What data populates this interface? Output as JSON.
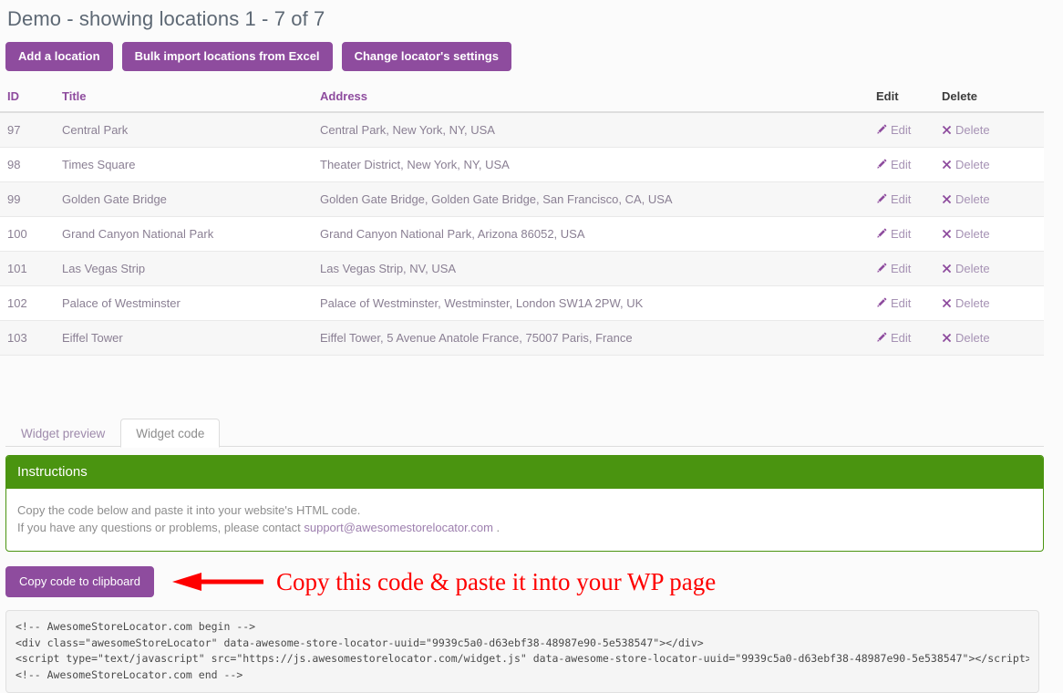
{
  "page": {
    "title": "Demo - showing locations 1 - 7 of 7",
    "accent_purple": "#8e4c9e",
    "accent_green": "#4a9410",
    "annotation_red": "#fe0000"
  },
  "toolbar": {
    "add_location_label": "Add a location",
    "bulk_import_label": "Bulk import locations from Excel",
    "settings_label": "Change locator's settings"
  },
  "table": {
    "columns": {
      "id": "ID",
      "title": "Title",
      "address": "Address",
      "edit": "Edit",
      "delete": "Delete"
    },
    "row_action_edit": "Edit",
    "row_action_delete": "Delete",
    "rows": [
      {
        "id": "97",
        "title": "Central Park",
        "address": "Central Park, New York, NY, USA"
      },
      {
        "id": "98",
        "title": "Times Square",
        "address": "Theater District, New York, NY, USA"
      },
      {
        "id": "99",
        "title": "Golden Gate Bridge",
        "address": "Golden Gate Bridge, Golden Gate Bridge, San Francisco, CA, USA"
      },
      {
        "id": "100",
        "title": "Grand Canyon National Park",
        "address": "Grand Canyon National Park, Arizona 86052, USA"
      },
      {
        "id": "101",
        "title": "Las Vegas Strip",
        "address": "Las Vegas Strip, NV, USA"
      },
      {
        "id": "102",
        "title": "Palace of Westminster",
        "address": "Palace of Westminster, Westminster, London SW1A 2PW, UK"
      },
      {
        "id": "103",
        "title": "Eiffel Tower",
        "address": "Eiffel Tower, 5 Avenue Anatole France, 75007 Paris, France"
      }
    ]
  },
  "tabs": {
    "preview_label": "Widget preview",
    "code_label": "Widget code",
    "active": "Widget code"
  },
  "instructions": {
    "heading": "Instructions",
    "line1": "Copy the code below and paste it into your website's HTML code.",
    "line2_prefix": "If you have any questions or problems, please contact ",
    "support_email": "support@awesomestorelocator.com",
    "line2_suffix": " ."
  },
  "copy": {
    "button_label": "Copy code to clipboard",
    "annotation": "Copy this code & paste it into your WP page"
  },
  "code_snippet": "<!-- AwesomeStoreLocator.com begin -->\n<div class=\"awesomeStoreLocator\" data-awesome-store-locator-uuid=\"9939c5a0-d63ebf38-48987e90-5e538547\"></div>\n<script type=\"text/javascript\" src=\"https://js.awesomestorelocator.com/widget.js\" data-awesome-store-locator-uuid=\"9939c5a0-d63ebf38-48987e90-5e538547\"></script>\n<!-- AwesomeStoreLocator.com end -->"
}
